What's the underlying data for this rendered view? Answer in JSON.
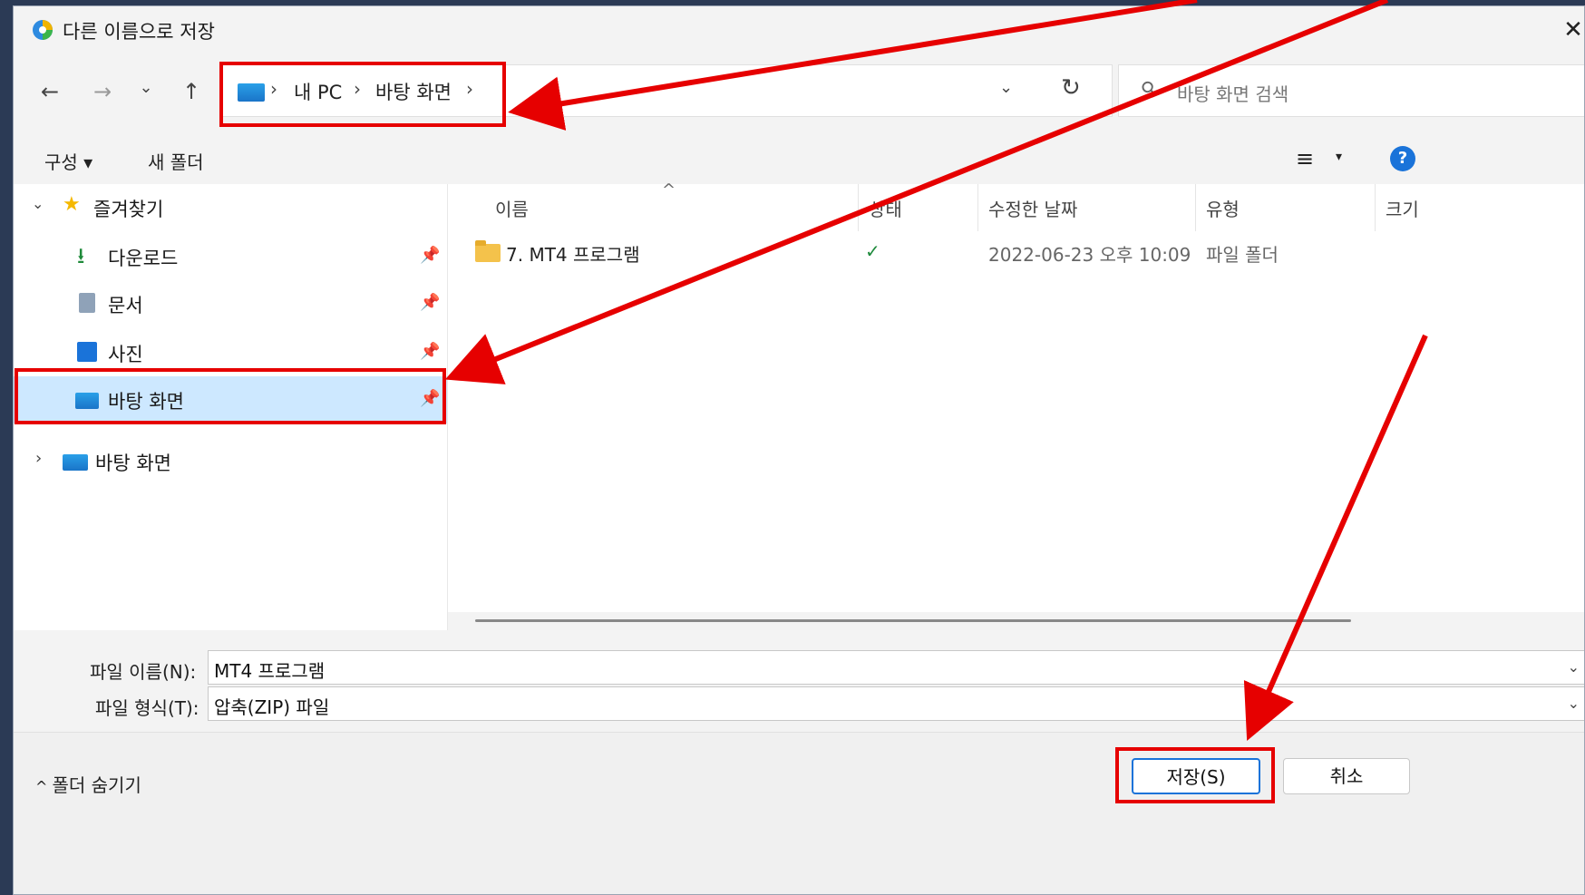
{
  "window": {
    "title": "다른 이름으로 저장",
    "close_symbol": "✕"
  },
  "nav": {
    "back": "←",
    "forward": "→",
    "recent": "⌄",
    "up": "↑"
  },
  "address": {
    "crumbs": [
      "내 PC",
      "바탕 화면"
    ],
    "separator": "›",
    "dropdown": "⌄",
    "refresh": "↻"
  },
  "search": {
    "placeholder": "바탕 화면 검색"
  },
  "toolbar": {
    "organize": "구성 ▾",
    "new_folder": "새 폴더",
    "view_icon": "≡",
    "view_dd": "▾",
    "help": "?"
  },
  "tree": {
    "favorites": "즐겨찾기",
    "items": [
      {
        "label": "다운로드",
        "icon": "download-icon"
      },
      {
        "label": "문서",
        "icon": "document-icon"
      },
      {
        "label": "사진",
        "icon": "picture-icon"
      },
      {
        "label": "바탕 화면",
        "icon": "desktop-icon"
      }
    ],
    "desktop_root": "바탕 화면"
  },
  "columns": {
    "name": "이름",
    "status": "상태",
    "modified": "수정한 날짜",
    "type": "유형",
    "size": "크기"
  },
  "files": [
    {
      "name": "7. MT4 프로그램",
      "status": "✓",
      "modified": "2022-06-23 오후 10:09",
      "type": "파일 폴더"
    }
  ],
  "form": {
    "filename_label": "파일 이름(N):",
    "filename_value": "MT4 프로그램",
    "filetype_label": "파일 형식(T):",
    "filetype_value": "압축(ZIP) 파일"
  },
  "footer": {
    "hide_folders": "폴더 숨기기",
    "save": "저장(S)",
    "cancel": "취소"
  },
  "colors": {
    "accent": "#1a73d9",
    "annotation": "#e60000",
    "selection": "#cde8ff"
  }
}
